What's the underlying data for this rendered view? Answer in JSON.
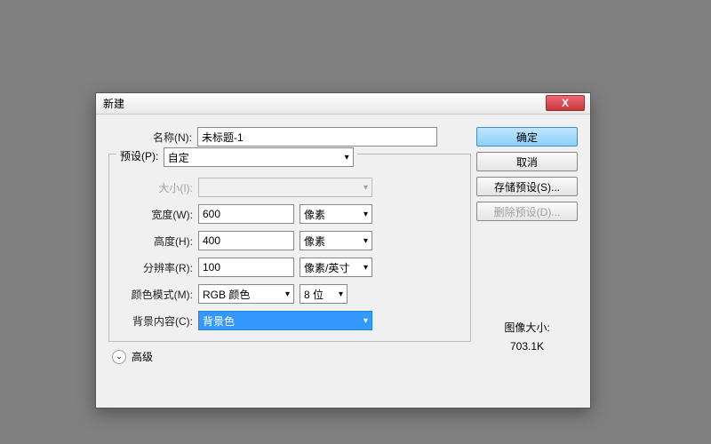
{
  "dialog": {
    "title": "新建",
    "close": "X"
  },
  "labels": {
    "name": "名称(N):",
    "preset": "预设(P):",
    "size": "大小(I):",
    "width": "宽度(W):",
    "height": "高度(H):",
    "resolution": "分辨率(R):",
    "colorMode": "颜色模式(M):",
    "backgroundContent": "背景内容(C):",
    "advanced": "高级"
  },
  "values": {
    "name": "未标题-1",
    "preset": "自定",
    "size": "",
    "width": "600",
    "height": "400",
    "resolution": "100",
    "colorMode": "RGB 颜色",
    "bitDepth": "8 位",
    "backgroundContent": "背景色"
  },
  "units": {
    "width": "像素",
    "height": "像素",
    "resolution": "像素/英寸"
  },
  "buttons": {
    "ok": "确定",
    "cancel": "取消",
    "savePreset": "存储预设(S)...",
    "deletePreset": "删除预设(D)..."
  },
  "imageSize": {
    "label": "图像大小:",
    "value": "703.1K"
  },
  "icons": {
    "dropdown": "▾",
    "advancedChevron": "⌄"
  }
}
